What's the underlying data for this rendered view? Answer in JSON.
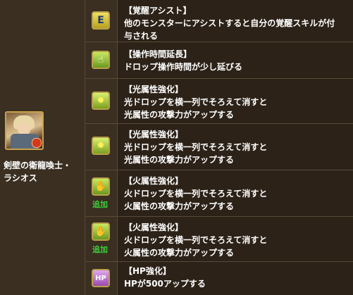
{
  "monster": {
    "name_line1": "剣壁の衛龍喚士・",
    "name_line2": "ラシオス"
  },
  "awakenings": [
    {
      "icon": "assist-awakening-icon",
      "icon_glyph": "E",
      "title": "【覚醒アシスト】",
      "lines": [
        "他のモンスターにアシストすると自分の覚醒スキルが付",
        "与される"
      ],
      "added": ""
    },
    {
      "icon": "extend-time-icon",
      "icon_glyph": "☝",
      "title": "【操作時間延長】",
      "lines": [
        "ドロップ操作時間が少し延びる"
      ],
      "added": ""
    },
    {
      "icon": "light-row-icon",
      "icon_glyph": "✸",
      "title": "【光属性強化】",
      "lines": [
        "光ドロップを横一列でそろえて消すと",
        "光属性の攻撃力がアップする"
      ],
      "added": ""
    },
    {
      "icon": "light-row-icon",
      "icon_glyph": "✸",
      "title": "【光属性強化】",
      "lines": [
        "光ドロップを横一列でそろえて消すと",
        "光属性の攻撃力がアップする"
      ],
      "added": ""
    },
    {
      "icon": "fire-row-icon",
      "icon_glyph": "✋",
      "title": "【火属性強化】",
      "lines": [
        "火ドロップを横一列でそろえて消すと",
        "火属性の攻撃力がアップする"
      ],
      "added": "追加"
    },
    {
      "icon": "fire-row-icon",
      "icon_glyph": "✋",
      "title": "【火属性強化】",
      "lines": [
        "火ドロップを横一列でそろえて消すと",
        "火属性の攻撃力がアップする"
      ],
      "added": "追加"
    },
    {
      "icon": "hp-plus-icon",
      "icon_glyph": "HP",
      "title": "【HP強化】",
      "lines": [
        "HPが500アップする"
      ],
      "added": ""
    }
  ]
}
